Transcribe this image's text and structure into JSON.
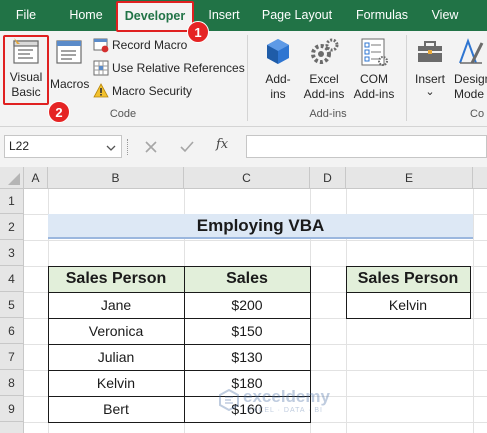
{
  "tabs": [
    {
      "label": "File"
    },
    {
      "label": "Home"
    },
    {
      "label": "Developer"
    },
    {
      "label": "Insert"
    },
    {
      "label": "Page Layout"
    },
    {
      "label": "Formulas"
    },
    {
      "label": "View"
    }
  ],
  "ribbon": {
    "code": {
      "visual_basic": "Visual Basic",
      "visual_basic_line1": "Visual",
      "visual_basic_line2": "Basic",
      "macros": "Macros",
      "record_macro": "Record Macro",
      "use_relative": "Use Relative References",
      "macro_security": "Macro Security",
      "group_label": "Code"
    },
    "addins": {
      "addins_line1": "Add-",
      "addins_line2": "ins",
      "excel_line1": "Excel",
      "excel_line2": "Add-ins",
      "com_line1": "COM",
      "com_line2": "Add-ins",
      "group_label": "Add-ins"
    },
    "controls": {
      "insert": "Insert",
      "insert_chevron": "⌄",
      "design_line1": "Design",
      "design_line2": "Mode",
      "group_label": "Co"
    }
  },
  "formula_bar": {
    "name_box": "L22",
    "fx": "fx",
    "formula": ""
  },
  "columns": [
    "A",
    "B",
    "C",
    "D",
    "E"
  ],
  "rows": [
    "1",
    "2",
    "3",
    "4",
    "5",
    "6",
    "7",
    "8",
    "9"
  ],
  "sheet": {
    "title": "Employing VBA",
    "table1": {
      "headers": [
        "Sales Person",
        "Sales"
      ],
      "rows": [
        [
          "Jane",
          "$200"
        ],
        [
          "Veronica",
          "$150"
        ],
        [
          "Julian",
          "$130"
        ],
        [
          "Kelvin",
          "$180"
        ],
        [
          "Bert",
          "$160"
        ]
      ]
    },
    "table2": {
      "header": "Sales Person",
      "value": "Kelvin"
    }
  },
  "badges": [
    "1",
    "2"
  ],
  "watermark": {
    "brand": "exceldemy",
    "tagline": "EXCEL · DATA · BI"
  }
}
